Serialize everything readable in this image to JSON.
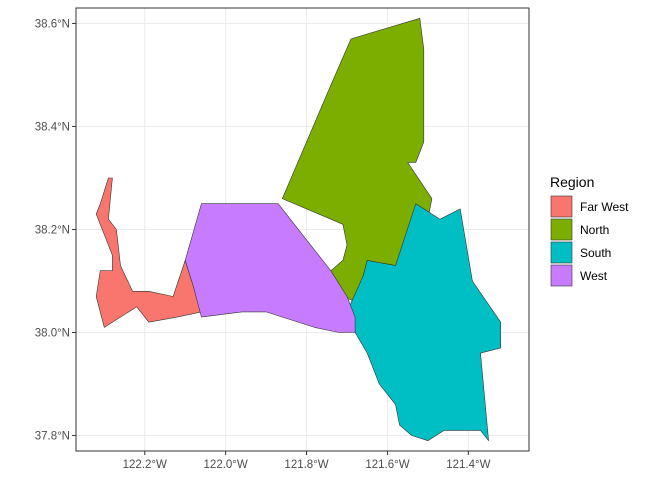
{
  "chart_data": {
    "type": "map",
    "title": "",
    "xlabel": "",
    "ylabel": "",
    "xlim": [
      -122.37,
      -121.25
    ],
    "ylim": [
      37.77,
      38.63
    ],
    "x_ticks": [
      {
        "value": -122.2,
        "label": "122.2°W"
      },
      {
        "value": -122.0,
        "label": "122.0°W"
      },
      {
        "value": -121.8,
        "label": "121.8°W"
      },
      {
        "value": -121.6,
        "label": "121.6°W"
      },
      {
        "value": -121.4,
        "label": "121.4°W"
      }
    ],
    "y_ticks": [
      {
        "value": 37.8,
        "label": "37.8°N"
      },
      {
        "value": 38.0,
        "label": "38.0°N"
      },
      {
        "value": 38.2,
        "label": "38.2°N"
      },
      {
        "value": 38.4,
        "label": "38.4°N"
      },
      {
        "value": 38.6,
        "label": "38.6°N"
      }
    ],
    "grid": true,
    "legend": {
      "title": "Region",
      "position": "right",
      "entries": [
        "Far West",
        "North",
        "South",
        "West"
      ]
    },
    "regions": [
      {
        "name": "Far West",
        "color": "#F8766D",
        "polygon": [
          [
            -122.29,
            38.3
          ],
          [
            -122.28,
            38.3
          ],
          [
            -122.29,
            38.22
          ],
          [
            -122.27,
            38.2
          ],
          [
            -122.26,
            38.13
          ],
          [
            -122.23,
            38.08
          ],
          [
            -122.19,
            38.08
          ],
          [
            -122.13,
            38.07
          ],
          [
            -122.1,
            38.14
          ],
          [
            -122.08,
            38.09
          ],
          [
            -122.06,
            38.04
          ],
          [
            -122.12,
            38.03
          ],
          [
            -122.19,
            38.02
          ],
          [
            -122.22,
            38.05
          ],
          [
            -122.3,
            38.01
          ],
          [
            -122.32,
            38.07
          ],
          [
            -122.31,
            38.12
          ],
          [
            -122.28,
            38.12
          ],
          [
            -122.28,
            38.15
          ],
          [
            -122.3,
            38.19
          ],
          [
            -122.32,
            38.23
          ],
          [
            -122.31,
            38.25
          ]
        ]
      },
      {
        "name": "North",
        "color": "#7CAE00",
        "polygon": [
          [
            -121.52,
            38.61
          ],
          [
            -121.51,
            38.55
          ],
          [
            -121.51,
            38.46
          ],
          [
            -121.51,
            38.37
          ],
          [
            -121.53,
            38.33
          ],
          [
            -121.55,
            38.33
          ],
          [
            -121.49,
            38.26
          ],
          [
            -121.53,
            38.1
          ],
          [
            -121.58,
            38.13
          ],
          [
            -121.65,
            38.14
          ],
          [
            -121.66,
            38.11
          ],
          [
            -121.68,
            38.06
          ],
          [
            -121.71,
            38.07
          ],
          [
            -121.74,
            38.08
          ],
          [
            -121.74,
            38.12
          ],
          [
            -121.71,
            38.14
          ],
          [
            -121.7,
            38.17
          ],
          [
            -121.71,
            38.21
          ],
          [
            -121.86,
            38.26
          ],
          [
            -121.74,
            38.48
          ],
          [
            -121.69,
            38.57
          ]
        ]
      },
      {
        "name": "South",
        "color": "#00BFC4",
        "polygon": [
          [
            -121.53,
            38.25
          ],
          [
            -121.58,
            38.13
          ],
          [
            -121.65,
            38.14
          ],
          [
            -121.66,
            38.11
          ],
          [
            -121.7,
            38.04
          ],
          [
            -121.68,
            38.0
          ],
          [
            -121.65,
            37.96
          ],
          [
            -121.62,
            37.9
          ],
          [
            -121.58,
            37.86
          ],
          [
            -121.57,
            37.82
          ],
          [
            -121.54,
            37.8
          ],
          [
            -121.5,
            37.79
          ],
          [
            -121.46,
            37.81
          ],
          [
            -121.42,
            37.81
          ],
          [
            -121.37,
            37.81
          ],
          [
            -121.35,
            37.79
          ],
          [
            -121.37,
            37.96
          ],
          [
            -121.32,
            37.97
          ],
          [
            -121.32,
            38.02
          ],
          [
            -121.39,
            38.1
          ],
          [
            -121.42,
            38.24
          ],
          [
            -121.47,
            38.22
          ]
        ]
      },
      {
        "name": "West",
        "color": "#C77CFF",
        "polygon": [
          [
            -122.06,
            38.25
          ],
          [
            -122.0,
            38.25
          ],
          [
            -121.87,
            38.25
          ],
          [
            -121.8,
            38.18
          ],
          [
            -121.74,
            38.12
          ],
          [
            -121.7,
            38.07
          ],
          [
            -121.68,
            38.03
          ],
          [
            -121.68,
            38.0
          ],
          [
            -121.72,
            38.0
          ],
          [
            -121.78,
            38.01
          ],
          [
            -121.9,
            38.04
          ],
          [
            -121.96,
            38.04
          ],
          [
            -122.06,
            38.03
          ],
          [
            -122.08,
            38.09
          ],
          [
            -122.1,
            38.14
          ]
        ]
      }
    ]
  }
}
